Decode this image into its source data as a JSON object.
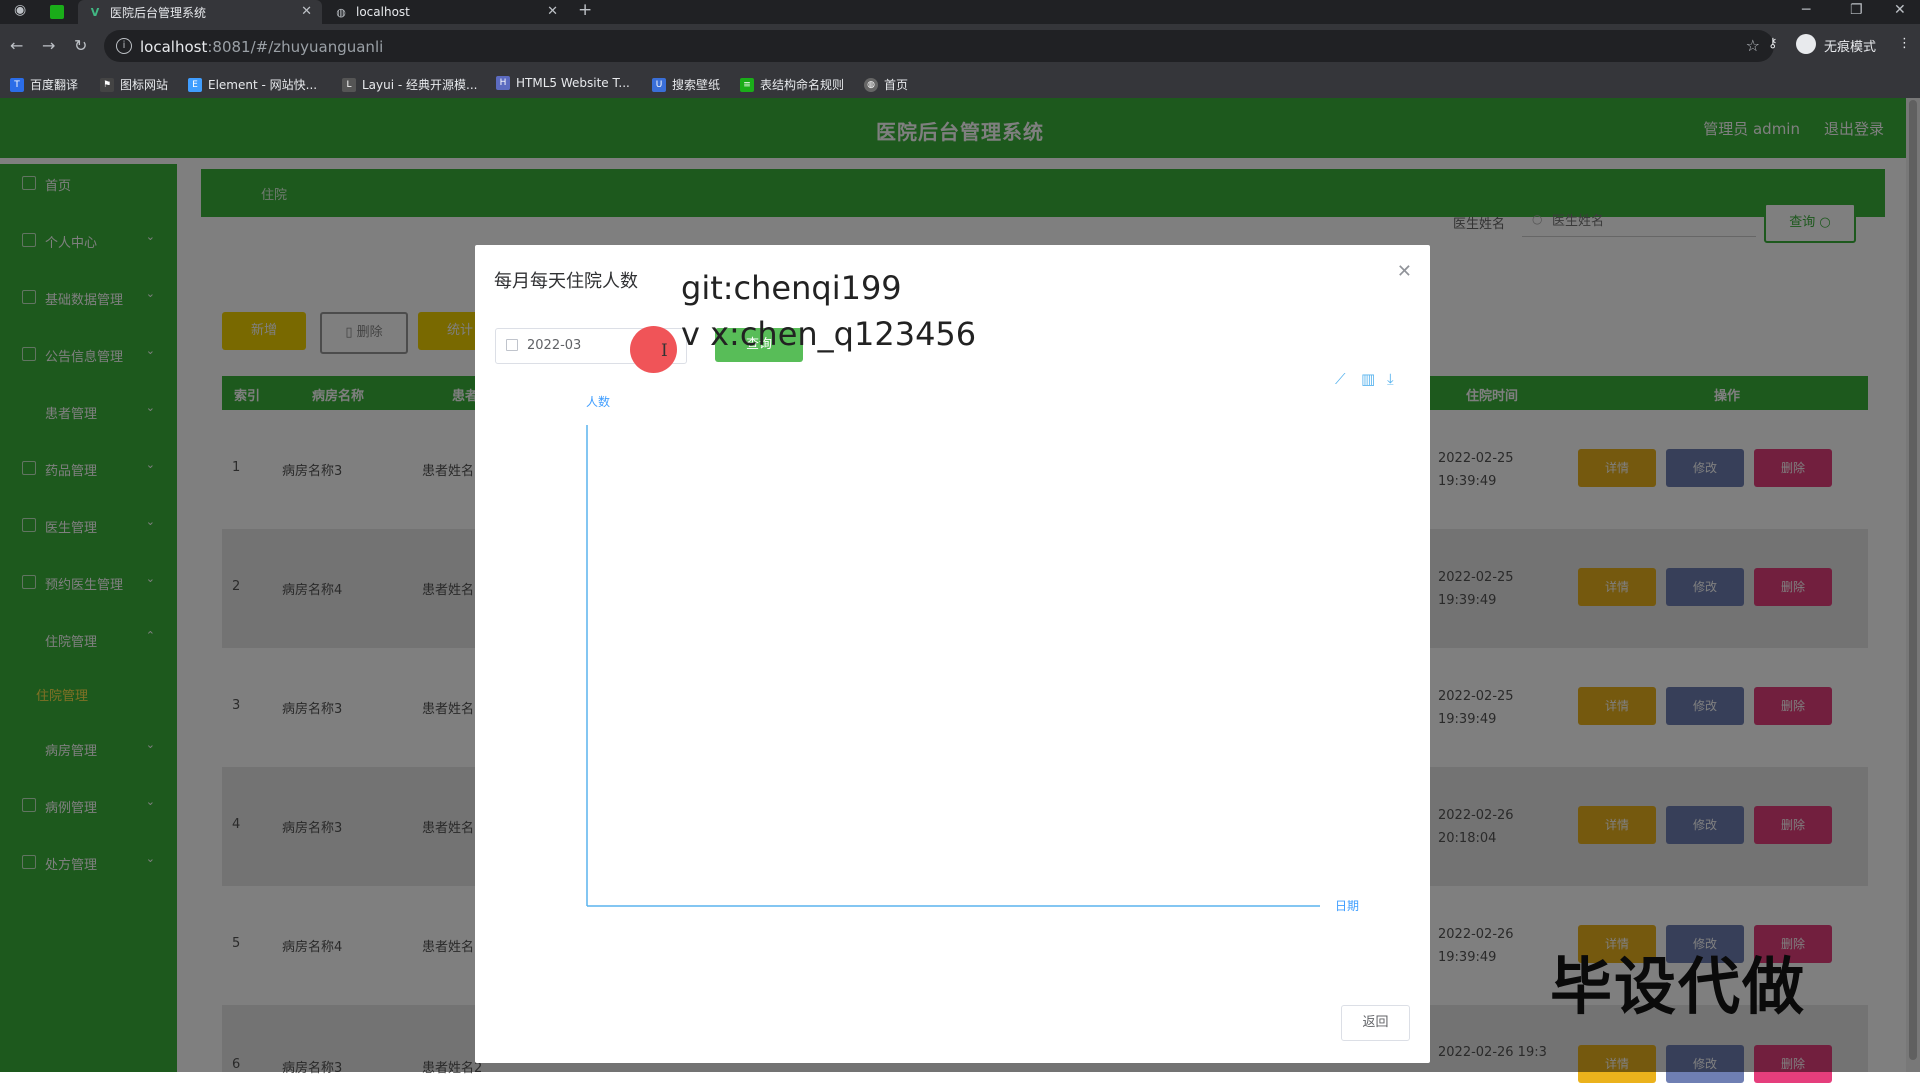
{
  "browser": {
    "tabs": [
      {
        "title": "医院后台管理系统",
        "active": true
      },
      {
        "title": "localhost",
        "active": false
      }
    ],
    "new_tab": "+",
    "url_host": "localhost",
    "url_rest": ":8081/#/zhuyuanguanli",
    "incognito_label": "无痕模式",
    "bookmarks": [
      "百度翻译",
      "图标网站",
      "Element - 网站快...",
      "Layui - 经典开源模...",
      "HTML5 Website T...",
      "搜索壁纸",
      "表结构命名规则",
      "首页"
    ]
  },
  "app": {
    "title": "医院后台管理系统",
    "user_label": "管理员 admin",
    "logout_label": "退出登录",
    "accent_color": "#3bb23b",
    "sidebar": {
      "items": [
        {
          "label": "首页",
          "arrow": ""
        },
        {
          "label": "个人中心",
          "arrow": "⌄"
        },
        {
          "label": "基础数据管理",
          "arrow": "⌄"
        },
        {
          "label": "公告信息管理",
          "arrow": "⌄"
        },
        {
          "label": "患者管理",
          "arrow": "⌄"
        },
        {
          "label": "药品管理",
          "arrow": "⌄"
        },
        {
          "label": "医生管理",
          "arrow": "⌄"
        },
        {
          "label": "预约医生管理",
          "arrow": "⌄"
        },
        {
          "label": "住院管理",
          "arrow": "⌃"
        },
        {
          "label": "病房管理",
          "arrow": "⌄"
        },
        {
          "label": "病例管理",
          "arrow": "⌄"
        },
        {
          "label": "处方管理",
          "arrow": "⌄"
        }
      ],
      "active_sub": "住院管理"
    },
    "breadcrumb": "住院",
    "search": {
      "label": "医生姓名",
      "placeholder": "医生姓名",
      "query_button": "查询"
    },
    "buttons": {
      "add": "新增",
      "delete": "删除",
      "stats": "统计"
    },
    "table": {
      "headers": {
        "index": "索引",
        "ward": "病房名称",
        "patient": "患者",
        "time": "住院时间",
        "ops": "操作"
      },
      "rows": [
        {
          "index": "1",
          "ward": "病房名称3",
          "patient": "患者姓名",
          "time": "2022-02-25 19:39:49"
        },
        {
          "index": "2",
          "ward": "病房名称4",
          "patient": "患者姓名",
          "time": "2022-02-25 19:39:49"
        },
        {
          "index": "3",
          "ward": "病房名称3",
          "patient": "患者姓名",
          "time": "2022-02-25 19:39:49"
        },
        {
          "index": "4",
          "ward": "病房名称3",
          "patient": "患者姓名",
          "time": "2022-02-26 20:18:04"
        },
        {
          "index": "5",
          "ward": "病房名称4",
          "patient": "患者姓名",
          "time": "2022-02-26 19:39:49"
        },
        {
          "index": "6",
          "ward": "病房名称3",
          "patient": "患者姓名2",
          "time": "2022-02-26 19:3"
        }
      ],
      "op_labels": {
        "detail": "详情",
        "edit": "修改",
        "remove": "删除"
      }
    }
  },
  "dialog": {
    "title": "每月每天住院人数",
    "date_value": "2022-03",
    "query_button": "查询",
    "watermark_line1": "git:chenqi199",
    "watermark_line2": "v x:chen_q123456",
    "return_button": "返回",
    "chart_data": {
      "type": "line",
      "title": "",
      "xlabel": "日期",
      "ylabel": "人数",
      "categories": [],
      "series": [],
      "grid": false,
      "toolbox": [
        "line-chart-icon",
        "bar-chart-icon",
        "download-icon"
      ]
    }
  },
  "promo_text": "毕设代做"
}
